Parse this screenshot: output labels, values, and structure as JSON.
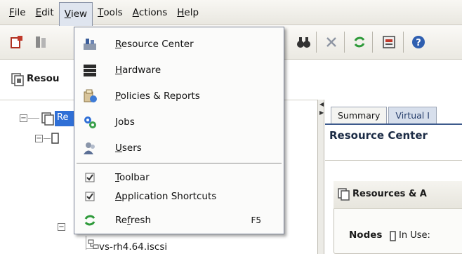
{
  "menubar": {
    "items": [
      {
        "label": "File",
        "u": "F",
        "rest": "ile"
      },
      {
        "label": "Edit",
        "u": "E",
        "rest": "dit"
      },
      {
        "label": "View",
        "u": "V",
        "rest": "iew"
      },
      {
        "label": "Tools",
        "u": "T",
        "rest": "ools"
      },
      {
        "label": "Actions",
        "u": "A",
        "rest": "ctions"
      },
      {
        "label": "Help",
        "u": "H",
        "rest": "elp"
      }
    ]
  },
  "left_panel": {
    "title": "Resou",
    "tree_selected": "Re",
    "tree_leaf": "vs-rh4.64.iscsi"
  },
  "right_panel": {
    "tabs": [
      "Summary",
      "Virtual I"
    ],
    "title": "Resource Center",
    "section_title": "Resources & A",
    "nodes_label": "Nodes",
    "in_use_label": "In Use:"
  },
  "view_menu": {
    "items": [
      {
        "pre": "",
        "u": "R",
        "post": "esource Center",
        "icon": "resource-center-icon"
      },
      {
        "pre": "",
        "u": "H",
        "post": "ardware",
        "icon": "hardware-icon"
      },
      {
        "pre": "",
        "u": "P",
        "post": "olicies & Reports",
        "icon": "policies-reports-icon"
      },
      {
        "pre": "",
        "u": "J",
        "post": "obs",
        "icon": "jobs-icon"
      },
      {
        "pre": "",
        "u": "U",
        "post": "sers",
        "icon": "users-icon"
      },
      {
        "pre": "",
        "u": "T",
        "post": "oolbar",
        "icon": "checkmark-icon"
      },
      {
        "pre": "",
        "u": "A",
        "post": "pplication Shortcuts",
        "icon": "checkmark-icon"
      },
      {
        "pre": "Re",
        "u": "f",
        "post": "resh",
        "icon": "refresh-icon",
        "shortcut": "F5"
      }
    ]
  },
  "colors": {
    "selection": "#2f6fd6",
    "tab_rule": "#3d5a8c",
    "refresh_green": "#2e9a3a"
  }
}
